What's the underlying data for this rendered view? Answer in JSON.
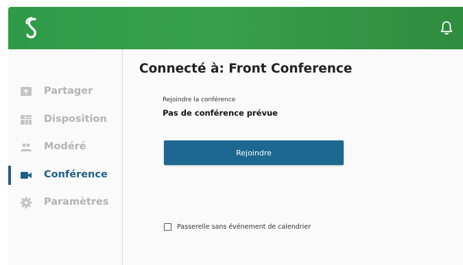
{
  "header": {
    "logo_icon": "brand-s-logo",
    "notification_icon": "bell-icon",
    "background_color": "#38a04c"
  },
  "sidebar": {
    "active_color": "#1d5f88",
    "items": [
      {
        "label": "Partager",
        "icon": "share-screen-icon",
        "active": false
      },
      {
        "label": "Disposition",
        "icon": "layout-icon",
        "active": false
      },
      {
        "label": "Modéré",
        "icon": "users-icon",
        "active": false
      },
      {
        "label": "Conférence",
        "icon": "video-camera-icon",
        "active": true
      },
      {
        "label": "Paramètres",
        "icon": "gear-icon",
        "active": false
      }
    ]
  },
  "main": {
    "title": "Connecté à: Front Conference",
    "join_label": "Rejoindre la conférence",
    "conference_value": "Pas de conférence prévue",
    "join_button": "Rejoindre",
    "button_color": "#1c6891",
    "gateway_checkbox_label": "Passerelle sans événement de calendrier",
    "gateway_checked": false
  }
}
